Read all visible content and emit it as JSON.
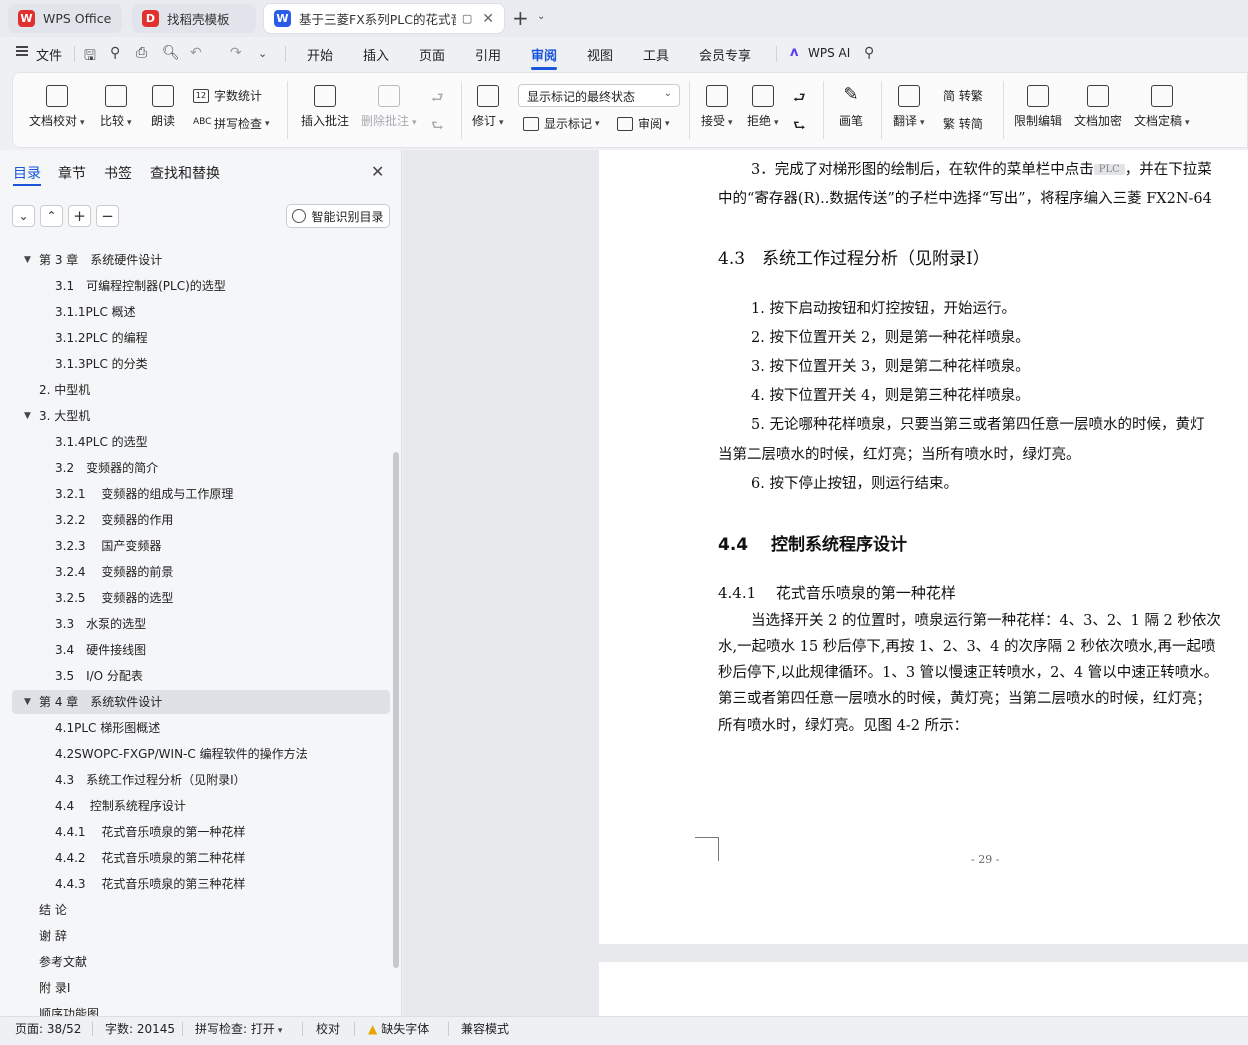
{
  "tabs": [
    {
      "title": "WPS Office",
      "logo": "W",
      "logo_color": "#e0312f"
    },
    {
      "title": "找稻壳模板",
      "logo": "D",
      "logo_color": "#e0312f"
    },
    {
      "title": "基于三菱FX系列PLC的花式音",
      "logo": "W",
      "logo_color": "#2b5ce8",
      "extra": "▢"
    }
  ],
  "menu": {
    "file": "文件",
    "items": [
      "开始",
      "插入",
      "页面",
      "引用",
      "审阅",
      "视图",
      "工具",
      "会员专享"
    ],
    "active": "审阅",
    "ai": "WPS AI"
  },
  "ribbon": {
    "doc_check": "文档校对",
    "compare": "比较",
    "read_aloud": "朗读",
    "word_count": "字数统计",
    "spell_check": "拼写检查",
    "insert_comment": "插入批注",
    "delete_comment": "删除批注",
    "revise": "修订",
    "markup_state": "显示标记的最终状态",
    "show_markup": "显示标记",
    "review": "审阅",
    "accept": "接受",
    "reject": "拒绝",
    "pen": "画笔",
    "translate": "翻译",
    "to_traditional": "简 转繁",
    "to_simplified": "繁 转简",
    "restrict_edit": "限制编辑",
    "encrypt": "文档加密",
    "finalize": "文档定稿"
  },
  "sidebar": {
    "tabs": [
      "目录",
      "章节",
      "书签",
      "查找和替换"
    ],
    "active_tab": "目录",
    "smart_btn": "智能识别目录",
    "toc": [
      {
        "text": "第 3 章　系统硬件设计",
        "level": 1,
        "toggle": "▼"
      },
      {
        "text": "3.1　可编程控制器(PLC)的选型",
        "level": 2
      },
      {
        "text": "3.1.1PLC 概述",
        "level": 2
      },
      {
        "text": "3.1.2PLC 的编程",
        "level": 2
      },
      {
        "text": "3.1.3PLC 的分类",
        "level": 2
      },
      {
        "text": "2. 中型机",
        "level": 1
      },
      {
        "text": "3. 大型机",
        "level": 1,
        "toggle": "▼"
      },
      {
        "text": "3.1.4PLC 的选型",
        "level": 2
      },
      {
        "text": "3.2　变频器的简介",
        "level": 2
      },
      {
        "text": "3.2.1　 变频器的组成与工作原理",
        "level": 2
      },
      {
        "text": "3.2.2　 变频器的作用",
        "level": 2
      },
      {
        "text": "3.2.3　 国产变频器",
        "level": 2
      },
      {
        "text": "3.2.4　 变频器的前景",
        "level": 2
      },
      {
        "text": "3.2.5　 变频器的选型",
        "level": 2
      },
      {
        "text": "3.3　水泵的选型",
        "level": 2
      },
      {
        "text": "3.4　硬件接线图",
        "level": 2
      },
      {
        "text": "3.5　I/O 分配表",
        "level": 2
      },
      {
        "text": "第 4 章　系统软件设计",
        "level": 1,
        "toggle": "▼",
        "selected": true
      },
      {
        "text": "4.1PLC 梯形图概述",
        "level": 2
      },
      {
        "text": "4.2SWOPC-FXGP/WIN-C 编程软件的操作方法",
        "level": 2
      },
      {
        "text": "4.3　系统工作过程分析（见附录Ⅰ）",
        "level": 2
      },
      {
        "text": "4.4　 控制系统程序设计",
        "level": 2
      },
      {
        "text": "4.4.1　 花式音乐喷泉的第一种花样",
        "level": 2
      },
      {
        "text": "4.4.2　 花式音乐喷泉的第二种花样",
        "level": 2
      },
      {
        "text": "4.4.3　 花式音乐喷泉的第三种花样",
        "level": 2
      },
      {
        "text": "结 论",
        "level": 1
      },
      {
        "text": "谢 辞",
        "level": 1
      },
      {
        "text": "参考文献",
        "level": 1
      },
      {
        "text": "附 录Ⅰ",
        "level": 1
      },
      {
        "text": "顺序功能图",
        "level": 1
      }
    ]
  },
  "document": {
    "line1a": "3．完成了对梯形图的绘制后，在软件的菜单栏中点击",
    "field": "PLC",
    "line1b": "，并在下拉菜",
    "line2": "中的“寄存器(R)..数据传送”的子栏中选择“写出”，将程序编入三菱 FX2N-64",
    "h43": "4.3　系统工作过程分析（见附录Ⅰ）",
    "steps": [
      "1.  按下启动按钮和灯控按钮，开始运行。",
      "2.  按下位置开关 2，则是第一种花样喷泉。",
      "3.  按下位置开关 3，则是第二种花样喷泉。",
      "4.  按下位置开关 4，则是第三种花样喷泉。",
      "5.  无论哪种花样喷泉，只要当第三或者第四任意一层喷水的时候，黄灯",
      "当第二层喷水的时候，红灯亮；当所有喷水时，绿灯亮。",
      "6.  按下停止按钮，则运行结束。"
    ],
    "h44": "4.4　 控制系统程序设计",
    "h441": "4.4.1　 花式音乐喷泉的第一种花样",
    "para": [
      "当选择开关 2 的位置时，喷泉运行第一种花样：4、3、2、1 隔 2 秒依次",
      "水,一起喷水 15 秒后停下,再按 1、2、3、4 的次序隔 2 秒依次喷水,再一起喷",
      "秒后停下,以此规律循环。1、3 管以慢速正转喷水，2、4 管以中速正转喷水。",
      "第三或者第四任意一层喷水的时候，黄灯亮；当第二层喷水的时候，红灯亮；",
      "所有喷水时，绿灯亮。见图 4-2 所示："
    ],
    "page_number": "- 29 -"
  },
  "status": {
    "page": "页面: 38/52",
    "words": "字数: 20145",
    "spell": "拼写检查: 打开",
    "proof": "校对",
    "missing_font": "缺失字体",
    "compat": "兼容模式"
  }
}
